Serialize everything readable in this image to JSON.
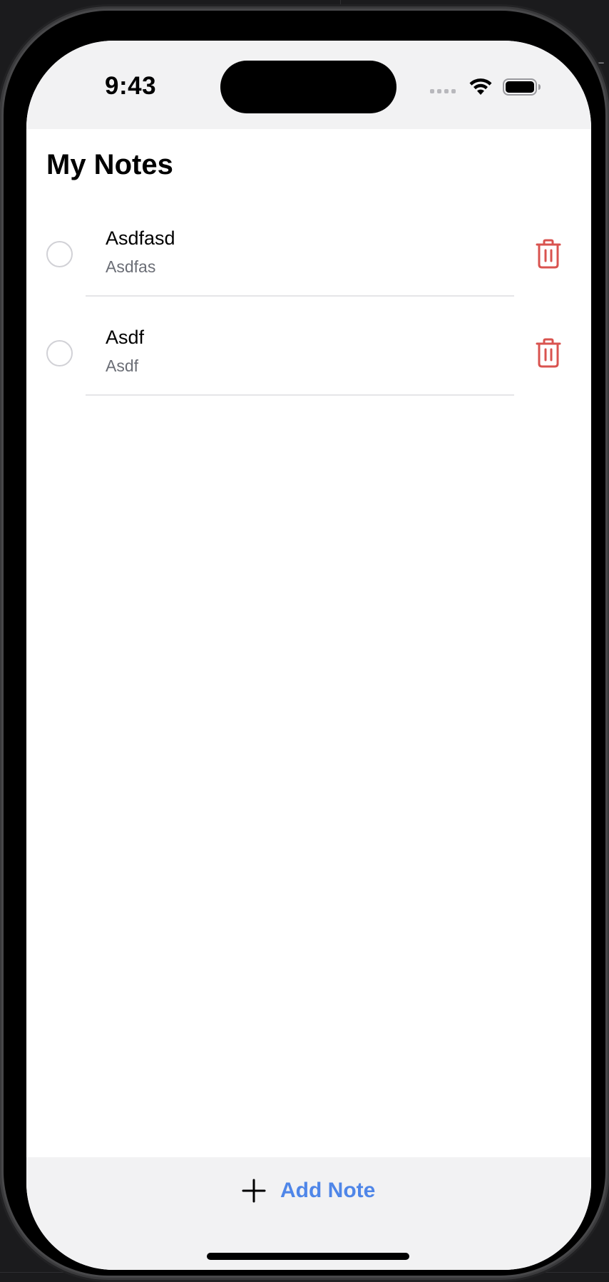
{
  "status_bar": {
    "time": "9:43"
  },
  "header": {
    "title": "My Notes"
  },
  "notes": [
    {
      "title": "Asdfasd",
      "body": "Asdfas",
      "completed": false
    },
    {
      "title": "Asdf",
      "body": "Asdf",
      "completed": false
    }
  ],
  "toolbar": {
    "add_note_label": "Add Note"
  },
  "colors": {
    "accent": "#4f86e8",
    "delete": "#d9534f",
    "secondary_text": "#6b6e76",
    "bar_background": "#f2f2f3"
  },
  "icons": {
    "wifi": "wifi-icon",
    "battery": "battery-icon",
    "delete": "trash-icon",
    "add": "plus-icon",
    "checkbox": "circle-checkbox-icon"
  }
}
